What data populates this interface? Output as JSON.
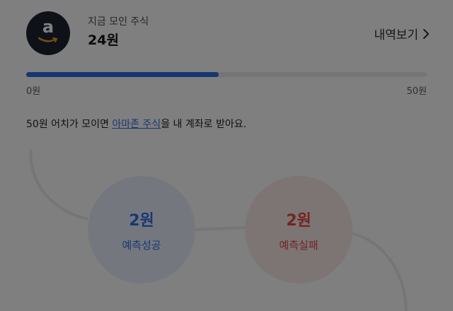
{
  "colors": {
    "accent": "#2f6fe8",
    "success": "#2f6fe8",
    "fail": "#e5483e",
    "overlay": "rgba(0,0,0,0.5)"
  },
  "header": {
    "logo_icon": "amazon-logo-icon",
    "label": "지금 모인 주식",
    "amount": "24원",
    "history_link": "내역보기",
    "history_icon": "chevron-right-icon"
  },
  "progress": {
    "current": 24,
    "max": 50,
    "min_label": "0원",
    "max_label": "50원"
  },
  "description": {
    "before": "50원 어치가 모이면 ",
    "link": "아마존 주식",
    "after": "을 내 계좌로 받아요."
  },
  "predictions": {
    "success": {
      "value": "2원",
      "label": "예측성공"
    },
    "fail": {
      "value": "2원",
      "label": "예측실패"
    }
  }
}
